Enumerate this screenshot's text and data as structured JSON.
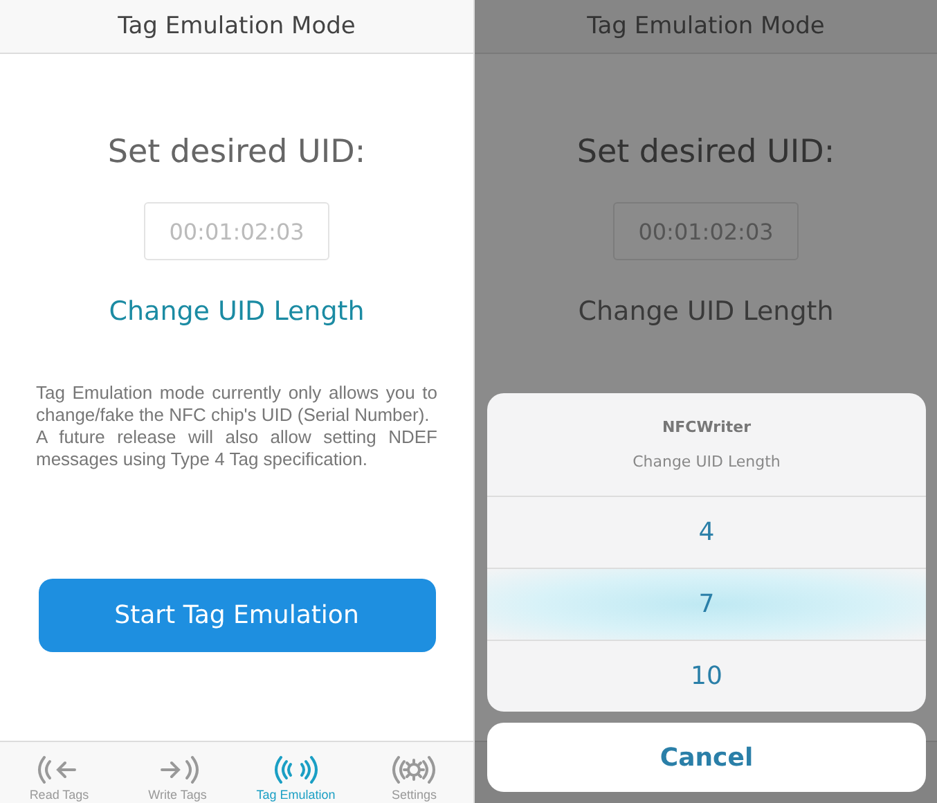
{
  "screens": [
    {
      "title": "Tag Emulation Mode",
      "heading": "Set desired UID:",
      "uid_field": {
        "placeholder": "00:01:02:03"
      },
      "link": "Change UID Length",
      "dimmed": false,
      "description": "Tag Emulation mode currently only allows you to change/fake the NFC chip's UID (Serial Number).\nA future release will also allow setting NDEF messages using Type 4 Tag specification.",
      "start_button": "Start Tag Emulation",
      "tabs": [
        {
          "label": "Read Tags",
          "kind": "read",
          "selected": false
        },
        {
          "label": "Write Tags",
          "kind": "write",
          "selected": false
        },
        {
          "label": "Tag Emulation",
          "kind": "emulate",
          "selected": true
        },
        {
          "label": "Settings",
          "kind": "settings",
          "selected": false
        }
      ]
    },
    {
      "title": "Tag Emulation Mode",
      "heading": "Set desired UID:",
      "uid_field": {
        "placeholder": "00:01:02:03"
      },
      "link": "Change UID Length",
      "dimmed": true,
      "action_sheet": {
        "title": "NFCWriter",
        "message": "Change UID Length",
        "options": [
          {
            "label": "4",
            "selected": false
          },
          {
            "label": "7",
            "selected": true
          },
          {
            "label": "10",
            "selected": false
          }
        ],
        "cancel": "Cancel"
      }
    }
  ]
}
